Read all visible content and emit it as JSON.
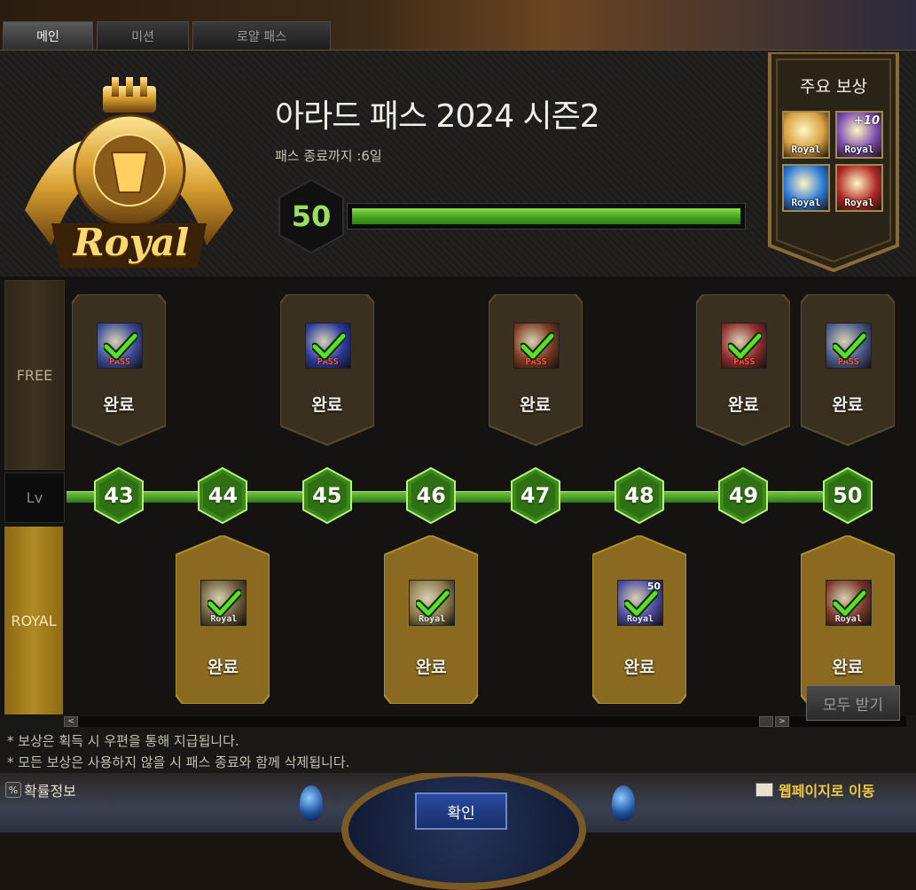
{
  "tabs": [
    {
      "label": "메인",
      "active": true
    },
    {
      "label": "미션",
      "active": false
    },
    {
      "label": "로얄 패스",
      "active": false
    }
  ],
  "header": {
    "emblem_text": "Royal",
    "title": "아라드 패스 2024 시즌2",
    "remaining": "패스 종료까지 :6일",
    "current_level": "50",
    "progress_fraction": 1.0
  },
  "key_rewards": {
    "title": "주요 보상",
    "items": [
      {
        "tag": "Royal",
        "icon": "golden-chest-icon",
        "color": "#d8a040"
      },
      {
        "tag": "Royal",
        "icon": "enhance-plus10-icon",
        "badge": "+10",
        "color": "#7a4ab0"
      },
      {
        "tag": "Royal",
        "icon": "blue-armor-icon",
        "color": "#2a78d8"
      },
      {
        "tag": "Royal",
        "icon": "red-gift-box-icon",
        "color": "#b02828"
      }
    ]
  },
  "rows": {
    "free_label": "FREE",
    "lv_label": "Lv",
    "royal_label": "ROYAL"
  },
  "levels": [
    "43",
    "44",
    "45",
    "46",
    "47",
    "48",
    "49",
    "50"
  ],
  "free_rewards": [
    {
      "level": "43",
      "tag": "PASS",
      "status": "완료",
      "color": "#3a4a9a"
    },
    {
      "level": "45",
      "tag": "PASS",
      "status": "완료",
      "color": "#2a3aa0"
    },
    {
      "level": "47",
      "tag": "PASS",
      "status": "완료",
      "color": "#7a3a20"
    },
    {
      "level": "49",
      "tag": "PASS",
      "status": "완료",
      "color": "#8a2a2a"
    },
    {
      "level": "50",
      "tag": "PASS",
      "status": "완료",
      "color": "#4a5a8a"
    }
  ],
  "royal_rewards": [
    {
      "level": "44",
      "tag": "Royal",
      "status": "완료",
      "color": "#6a5a3a"
    },
    {
      "level": "46",
      "tag": "Royal",
      "status": "완료",
      "color": "#8a7a4a"
    },
    {
      "level": "48",
      "tag": "Royal",
      "badge": "50",
      "status": "완료",
      "color": "#4a4aa0"
    },
    {
      "level": "50",
      "tag": "Royal",
      "status": "완료",
      "color": "#7a3a2a"
    }
  ],
  "footer": {
    "note1": "* 보상은 획득 시 우편을 통해 지급됩니다.",
    "note2": "* 모든 보상은 사용하지 않을 시 패스 종료와 함께 삭제됩니다.",
    "claim_all": "모두 받기",
    "odds_icon": "%",
    "odds": "확률정보",
    "confirm": "확인",
    "webpage": "웹페이지로 이동"
  }
}
